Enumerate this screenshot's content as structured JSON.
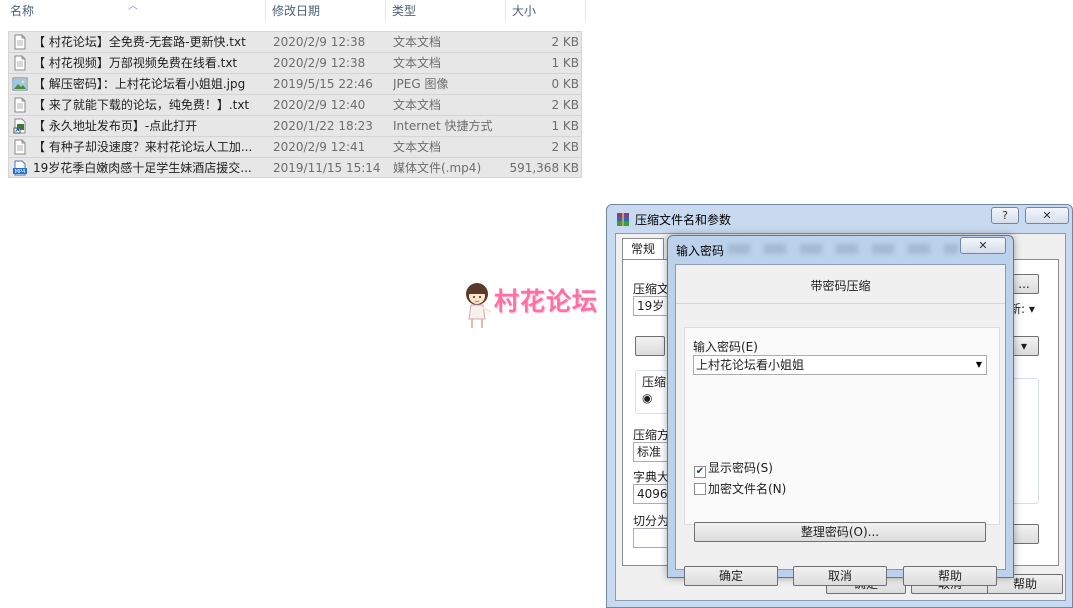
{
  "columns": {
    "name": "名称",
    "date": "修改日期",
    "type": "类型",
    "size": "大小"
  },
  "files": [
    {
      "icon": "text-file-icon",
      "name": "【 村花论坛】全免费-无套路-更新快.txt",
      "date": "2020/2/9 12:38",
      "type": "文本文档",
      "size": "2 KB"
    },
    {
      "icon": "text-file-icon",
      "name": "【 村花视频】万部视频免费在线看.txt",
      "date": "2020/2/9 12:38",
      "type": "文本文档",
      "size": "1 KB"
    },
    {
      "icon": "image-file-icon",
      "name": "【 解压密码】：上村花论坛看小姐姐.jpg",
      "date": "2019/5/15 22:46",
      "type": "JPEG 图像",
      "size": "0 KB"
    },
    {
      "icon": "text-file-icon",
      "name": "【 来了就能下载的论坛，纯免费！】.txt",
      "date": "2020/2/9 12:40",
      "type": "文本文档",
      "size": "2 KB"
    },
    {
      "icon": "shortcut-file-icon",
      "name": "【 永久地址发布页】-点此打开",
      "date": "2020/1/22 18:23",
      "type": "Internet 快捷方式",
      "size": "1 KB"
    },
    {
      "icon": "text-file-icon",
      "name": "【 有种子却没速度？来村花论坛人工加...",
      "date": "2020/2/9 12:41",
      "type": "文本文档",
      "size": "2 KB"
    },
    {
      "icon": "mp4-file-icon",
      "name": "19岁花季白嫩肉感十足学生妹酒店援交...",
      "date": "2019/11/15 15:14",
      "type": "媒体文件(.mp4)",
      "size": "591,368 KB"
    }
  ],
  "watermark": {
    "text": "村花论坛"
  },
  "main_dialog": {
    "title": "压缩文件名和参数",
    "help_label": "?",
    "close_label": "✕",
    "tab_general": "常规",
    "archive_label": "压缩文",
    "archive_value": "19岁",
    "browse_label": "...",
    "update_label": "新:",
    "compress_group_label": "压缩",
    "method_label": "压缩方",
    "method_value": "标准",
    "dict_label": "字典大",
    "dict_value": "4096",
    "split_label": "切分为",
    "ok_label": "确定",
    "cancel_label": "取消",
    "help_button_label": "帮助"
  },
  "password_dialog": {
    "title": "输入密码",
    "close_label": "✕",
    "heading": "带密码压缩",
    "password_label": "输入密码(E)",
    "password_value": "上村花论坛看小姐姐",
    "show_password_label": "显示密码(S)",
    "show_password_checked": true,
    "encrypt_names_label": "加密文件名(N)",
    "encrypt_names_checked": false,
    "organize_label": "整理密码(O)...",
    "ok_label": "确定",
    "cancel_label": "取消",
    "help_label": "帮助"
  }
}
